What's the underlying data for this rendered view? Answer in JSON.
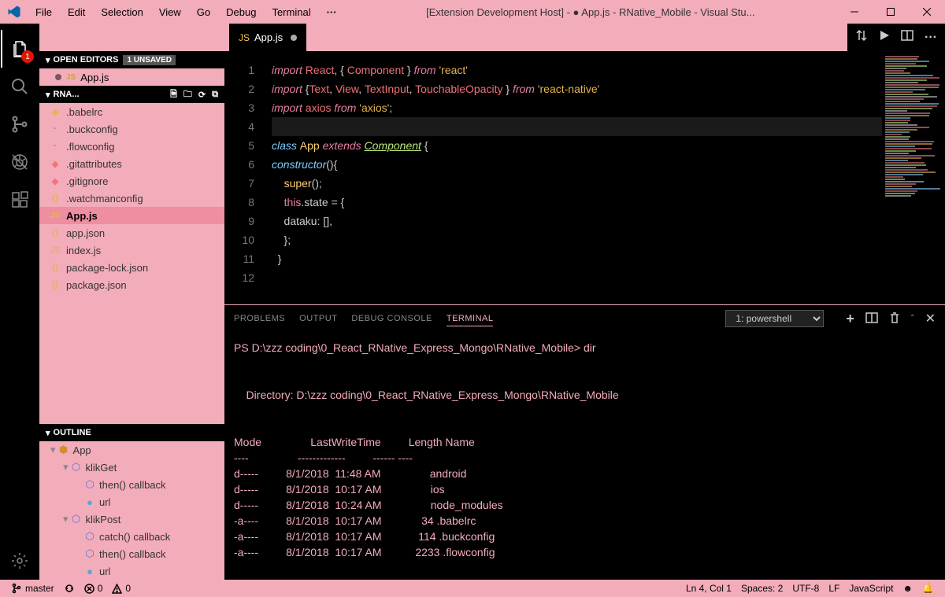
{
  "titlebar": {
    "menu": [
      "File",
      "Edit",
      "Selection",
      "View",
      "Go",
      "Debug",
      "Terminal"
    ],
    "title": "[Extension Development Host] - ● App.js - RNative_Mobile - Visual Stu..."
  },
  "activitybar": {
    "explorer_badge": "1"
  },
  "sidebar": {
    "open_editors_label": "Open Editors",
    "unsaved_label": "1 UNSAVED",
    "open_editor_file": "App.js",
    "project_label": "RNA...",
    "files": [
      {
        "icon": "◈",
        "color": "#e6b450",
        "name": ".babelrc"
      },
      {
        "icon": "·",
        "color": "#888",
        "name": ".buckconfig"
      },
      {
        "icon": "·",
        "color": "#888",
        "name": ".flowconfig"
      },
      {
        "icon": "◈",
        "color": "#f07178",
        "name": ".gitattributes"
      },
      {
        "icon": "◈",
        "color": "#f07178",
        "name": ".gitignore"
      },
      {
        "icon": "{}",
        "color": "#e6b450",
        "name": ".watchmanconfig"
      },
      {
        "icon": "JS",
        "color": "#e6b450",
        "name": "App.js",
        "selected": true
      },
      {
        "icon": "{}",
        "color": "#e6b450",
        "name": "app.json"
      },
      {
        "icon": "JS",
        "color": "#e6b450",
        "name": "index.js"
      },
      {
        "icon": "{}",
        "color": "#e6b450",
        "name": "package-lock.json"
      },
      {
        "icon": "{}",
        "color": "#e6b450",
        "name": "package.json"
      }
    ],
    "outline_label": "Outline",
    "outline": [
      {
        "depth": 0,
        "icon": "⬢",
        "color": "#d28f2c",
        "name": "App"
      },
      {
        "depth": 1,
        "icon": "⬡",
        "color": "#5a7bd4",
        "name": "klikGet"
      },
      {
        "depth": 2,
        "icon": "⬡",
        "color": "#5a7bd4",
        "name": "then() callback"
      },
      {
        "depth": 2,
        "icon": "●",
        "color": "#5aa7d4",
        "name": "url"
      },
      {
        "depth": 1,
        "icon": "⬡",
        "color": "#5a7bd4",
        "name": "klikPost"
      },
      {
        "depth": 2,
        "icon": "⬡",
        "color": "#5a7bd4",
        "name": "catch() callback"
      },
      {
        "depth": 2,
        "icon": "⬡",
        "color": "#5a7bd4",
        "name": "then() callback"
      },
      {
        "depth": 2,
        "icon": "●",
        "color": "#5aa7d4",
        "name": "url"
      }
    ]
  },
  "editor": {
    "tab_file": "App.js",
    "tab_icon": "JS",
    "code_tokens": [
      [
        {
          "t": "import ",
          "c": "kw"
        },
        {
          "t": "React",
          "c": "var"
        },
        {
          "t": ", { ",
          "c": "punc"
        },
        {
          "t": "Component",
          "c": "var"
        },
        {
          "t": " } ",
          "c": "punc"
        },
        {
          "t": "from ",
          "c": "kw"
        },
        {
          "t": "'react'",
          "c": "str"
        }
      ],
      [
        {
          "t": "import ",
          "c": "kw"
        },
        {
          "t": "{",
          "c": "punc"
        },
        {
          "t": "Text",
          "c": "var"
        },
        {
          "t": ", ",
          "c": "punc"
        },
        {
          "t": "View",
          "c": "var"
        },
        {
          "t": ", ",
          "c": "punc"
        },
        {
          "t": "TextInput",
          "c": "var"
        },
        {
          "t": ", ",
          "c": "punc"
        },
        {
          "t": "TouchableOpacity",
          "c": "var"
        },
        {
          "t": " } ",
          "c": "punc"
        },
        {
          "t": "from ",
          "c": "kw"
        },
        {
          "t": "'react-native'",
          "c": "str"
        }
      ],
      [
        {
          "t": "import ",
          "c": "kw"
        },
        {
          "t": "axios",
          "c": "var"
        },
        {
          "t": " from ",
          "c": "kw"
        },
        {
          "t": "'axios'",
          "c": "str"
        },
        {
          "t": ";",
          "c": "punc"
        }
      ],
      [],
      [
        {
          "t": "class ",
          "c": "cls"
        },
        {
          "t": "App ",
          "c": "fn"
        },
        {
          "t": "extends ",
          "c": "kw"
        },
        {
          "t": "Component",
          "c": "comp"
        },
        {
          "t": " {",
          "c": "punc"
        }
      ],
      [
        {
          "t": "constructor",
          "c": "cls"
        },
        {
          "t": "(){",
          "c": "punc"
        }
      ],
      [
        {
          "t": "    ",
          "c": ""
        },
        {
          "t": "super",
          "c": "fn"
        },
        {
          "t": "();",
          "c": "punc"
        }
      ],
      [
        {
          "t": "    ",
          "c": ""
        },
        {
          "t": "this",
          "c": "this"
        },
        {
          "t": ".state = {",
          "c": "punc"
        }
      ],
      [
        {
          "t": "    dataku: [],",
          "c": "punc"
        }
      ],
      [
        {
          "t": "    };",
          "c": "punc"
        }
      ],
      [
        {
          "t": "  }",
          "c": "punc"
        }
      ],
      []
    ],
    "line_start": 1,
    "current_line": 4
  },
  "panel": {
    "tabs": [
      "PROBLEMS",
      "OUTPUT",
      "DEBUG CONSOLE",
      "TERMINAL"
    ],
    "active_tab": 3,
    "terminal_selector": "1: powershell",
    "terminal_lines": [
      "PS D:\\zzz coding\\0_React_RNative_Express_Mongo\\RNative_Mobile> dir",
      "",
      "",
      "    Directory: D:\\zzz coding\\0_React_RNative_Express_Mongo\\RNative_Mobile",
      "",
      "",
      "Mode                LastWriteTime         Length Name",
      "----                -------------         ------ ----",
      "d-----         8/1/2018  11:48 AM                android",
      "d-----         8/1/2018  10:17 AM                ios",
      "d-----         8/1/2018  10:24 AM                node_modules",
      "-a----         8/1/2018  10:17 AM             34 .babelrc",
      "-a----         8/1/2018  10:17 AM            114 .buckconfig",
      "-a----         8/1/2018  10:17 AM           2233 .flowconfig"
    ]
  },
  "statusbar": {
    "branch": "master",
    "errors": "0",
    "warnings": "0",
    "ln_col": "Ln 4, Col 1",
    "spaces": "Spaces: 2",
    "encoding": "UTF-8",
    "eol": "LF",
    "lang": "JavaScript"
  }
}
